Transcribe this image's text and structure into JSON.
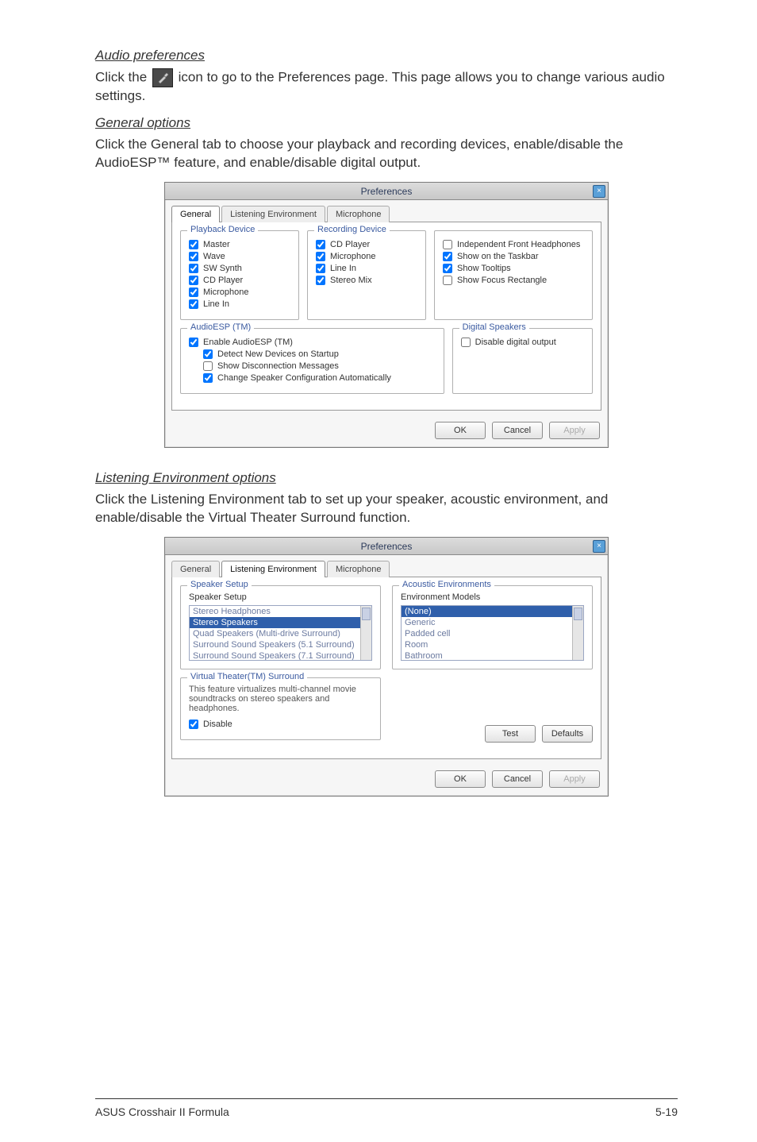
{
  "doc": {
    "audio_pref_heading": "Audio preferences",
    "audio_pref_body_a": "Click the ",
    "audio_pref_body_b": " icon to go to the Preferences page. This page allows you to change various audio settings.",
    "general_heading": "General options",
    "general_body": "Click the General tab to choose your playback and recording devices, enable/disable the AudioESP™ feature, and enable/disable digital output.",
    "listening_heading": "Listening Environment options",
    "listening_body": "Click the Listening Environment tab to set up your speaker, acoustic environment, and enable/disable the Virtual Theater Surround function.",
    "footer_left": "ASUS Crosshair II Formula",
    "footer_right": "5-19"
  },
  "dialog1": {
    "title": "Preferences",
    "tabs": {
      "general": "General",
      "listening": "Listening Environment",
      "microphone": "Microphone"
    },
    "playback": {
      "title": "Playback Device",
      "items": [
        "Master",
        "Wave",
        "SW Synth",
        "CD Player",
        "Microphone",
        "Line In"
      ]
    },
    "recording": {
      "title": "Recording Device",
      "items": [
        "CD Player",
        "Microphone",
        "Line In",
        "Stereo Mix"
      ]
    },
    "right": {
      "independent": "Independent Front Headphones",
      "taskbar": "Show on the Taskbar",
      "tooltips": "Show Tooltips",
      "focus": "Show Focus Rectangle"
    },
    "audioesp": {
      "title": "AudioESP (TM)",
      "enable": "Enable AudioESP (TM)",
      "detect": "Detect New Devices on Startup",
      "showdisc": "Show Disconnection Messages",
      "changespk": "Change Speaker Configuration Automatically"
    },
    "digital": {
      "title": "Digital Speakers",
      "disable": "Disable digital output"
    },
    "buttons": {
      "ok": "OK",
      "cancel": "Cancel",
      "apply": "Apply"
    }
  },
  "dialog2": {
    "title": "Preferences",
    "tabs": {
      "general": "General",
      "listening": "Listening Environment",
      "microphone": "Microphone"
    },
    "speaker_setup": {
      "title": "Speaker Setup",
      "label": "Speaker Setup",
      "items": [
        "Stereo Headphones",
        "Stereo Speakers",
        "Quad Speakers (Multi-drive Surround)",
        "Surround Sound Speakers (5.1 Surround)",
        "Surround Sound Speakers (7.1 Surround)"
      ],
      "selected_index": 1
    },
    "acoustic": {
      "title": "Acoustic Environments",
      "label": "Environment Models",
      "items": [
        "(None)",
        "Generic",
        "Padded cell",
        "Room",
        "Bathroom"
      ],
      "selected_index": 0
    },
    "virtual": {
      "title": "Virtual Theater(TM) Surround",
      "desc": "This feature virtualizes multi-channel movie soundtracks on stereo speakers and headphones.",
      "disable": "Disable"
    },
    "buttons": {
      "test": "Test",
      "defaults": "Defaults",
      "ok": "OK",
      "cancel": "Cancel",
      "apply": "Apply"
    }
  }
}
